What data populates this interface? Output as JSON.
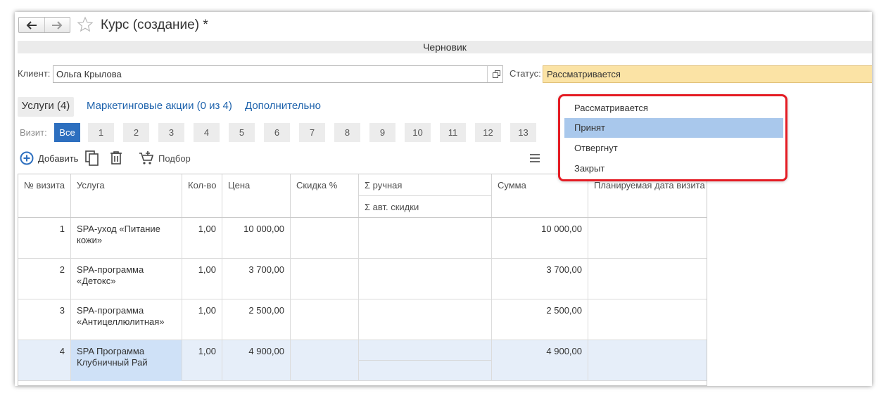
{
  "window": {
    "title": "Курс (создание) *",
    "state_banner": "Черновик"
  },
  "form": {
    "client_label": "Клиент:",
    "client_value": "Ольга Крылова",
    "status_label": "Статус:",
    "status_value": "Рассматривается"
  },
  "tabs": [
    {
      "label": "Услуги (4)"
    },
    {
      "label": "Маркетинговые акции (0 из 4)"
    },
    {
      "label": "Дополнительно"
    }
  ],
  "visits": {
    "label": "Визит:",
    "buttons": [
      "Все",
      "1",
      "2",
      "3",
      "4",
      "5",
      "6",
      "7",
      "8",
      "9",
      "10",
      "11",
      "12",
      "13"
    ]
  },
  "toolbar": {
    "add_label": "Добавить",
    "pick_label": "Подбор"
  },
  "table": {
    "headers": {
      "visit_no": "№ визита",
      "service": "Услуга",
      "qty": "Кол-во",
      "price": "Цена",
      "discount": "Скидка %",
      "manual": "Σ ручная",
      "auto": "Σ авт. скидки",
      "sum": "Сумма",
      "planned_date": "Планируемая дата визита"
    },
    "rows": [
      {
        "no": "1",
        "service": "SPA-уход «Питание кожи»",
        "qty": "1,00",
        "price": "10 000,00",
        "sum": "10 000,00"
      },
      {
        "no": "2",
        "service": "SPA-программа «Детокс»",
        "qty": "1,00",
        "price": "3 700,00",
        "sum": "3 700,00"
      },
      {
        "no": "3",
        "service": "SPA-программа «Антицеллюлитная»",
        "qty": "1,00",
        "price": "2 500,00",
        "sum": "2 500,00"
      },
      {
        "no": "4",
        "service": "SPA Программа Клубничный Рай",
        "qty": "1,00",
        "price": "4 900,00",
        "sum": "4 900,00"
      }
    ]
  },
  "status_dropdown": {
    "options": [
      "Рассматривается",
      "Принят",
      "Отвергнут",
      "Закрыт"
    ],
    "highlighted": "Принят"
  },
  "colors": {
    "accent": "#2d6fbf",
    "link": "#1d62ac",
    "status_field": "#fbe3a5",
    "highlight": "#a9c8ec",
    "callout": "#e41b23"
  }
}
